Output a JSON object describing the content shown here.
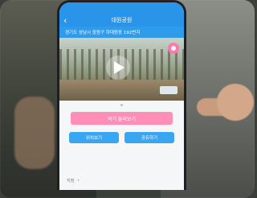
{
  "status": {
    "left": "",
    "time": "",
    "right": ""
  },
  "navbar": {
    "back_glyph": "‹",
    "title": "대원공원"
  },
  "caption": {
    "text": "경기도 성남시 중원구 하대원동 192번지"
  },
  "media": {
    "play_icon": "play-icon",
    "pin_icon": "location-pin-icon",
    "thumb_badge_icon": "camera-icon"
  },
  "cta": {
    "primary": "여기 둘러보기",
    "left": "위치보기",
    "right": "공유하기"
  },
  "footer": {
    "label": "지점",
    "chevron": "›"
  },
  "colors": {
    "brand": "#2a95e8",
    "accent_pink": "#ff8fb6"
  }
}
